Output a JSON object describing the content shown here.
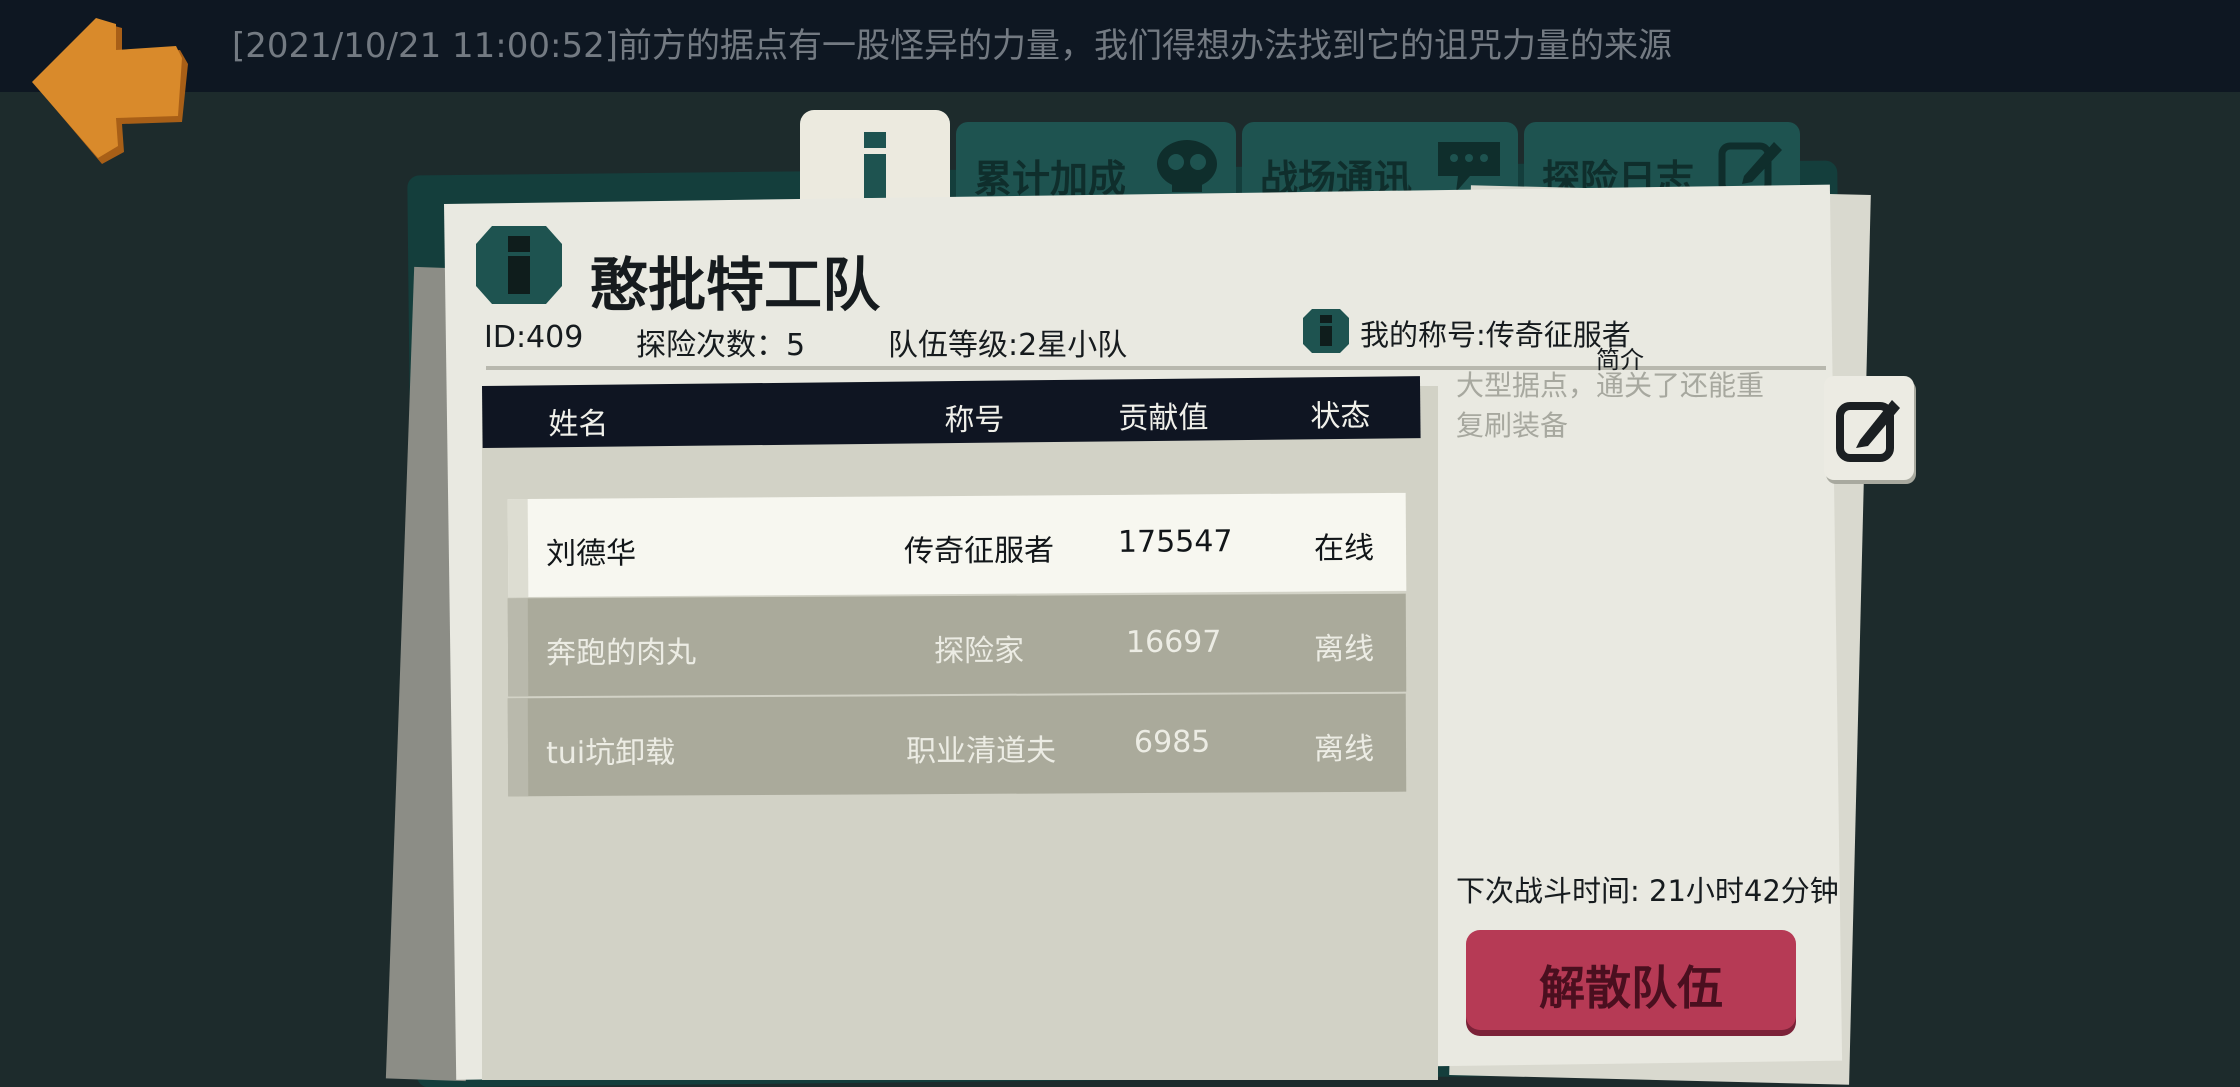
{
  "top_message": "[2021/10/21 11:00:52]前方的据点有一股怪异的力量，我们得想办法找到它的诅咒力量的来源",
  "tabs": [
    {
      "label": "累计加成",
      "icon": "skull-icon"
    },
    {
      "label": "战场通讯",
      "icon": "chat-bubble-icon"
    },
    {
      "label": "探险日志",
      "icon": "edit-icon"
    }
  ],
  "team": {
    "name": "憨批特工队",
    "id_label": "ID:409",
    "explore_label": "探险次数：5",
    "level_label": "队伍等级:2星小队"
  },
  "my_title": "我的称号:传奇征服者",
  "brief": {
    "label": "简介",
    "text": "大型据点，通关了还能重复刷装备"
  },
  "table": {
    "headers": [
      "姓名",
      "称号",
      "贡献值",
      "状态"
    ],
    "rows": [
      {
        "name": "刘德华",
        "title": "传奇征服者",
        "contribution": "175547",
        "status": "在线"
      },
      {
        "name": "奔跑的肉丸",
        "title": "探险家",
        "contribution": "16697",
        "status": "离线"
      },
      {
        "name": "tui坑卸载",
        "title": "职业清道夫",
        "contribution": "6985",
        "status": "离线"
      }
    ]
  },
  "next_battle": "下次战斗时间: 21小时42分钟",
  "disband_label": "解散队伍",
  "colors": {
    "background": "#1d2b2c",
    "board": "#143e3c",
    "tab": "#1e5350",
    "disband": "#b63a55",
    "back_arrow": "#d98a2b"
  }
}
